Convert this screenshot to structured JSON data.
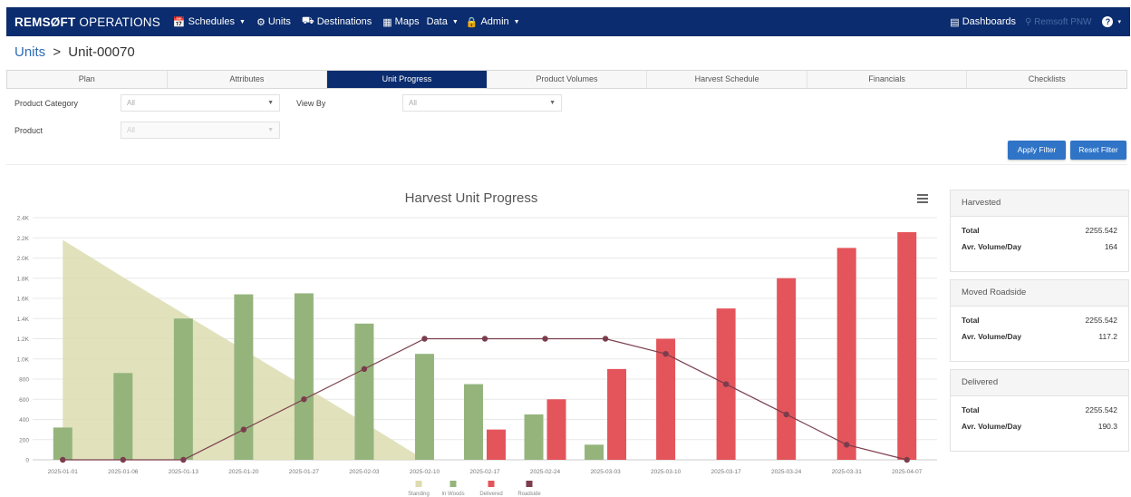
{
  "nav": {
    "brand": "REMSØFT",
    "brand_suffix": "OPERATIONS",
    "items": [
      {
        "label": "Schedules",
        "icon": "calendar-icon"
      },
      {
        "label": "Units",
        "icon": "units-icon"
      },
      {
        "label": "Destinations",
        "icon": "truck-icon"
      },
      {
        "label": "Maps",
        "icon": "map-icon"
      },
      {
        "label": "Data"
      },
      {
        "label": "Admin",
        "icon": "lock-icon"
      }
    ],
    "dashboards": "Dashboards",
    "org": "Remsoft PNW",
    "help_caret": "▾"
  },
  "breadcrumb": {
    "parent": "Units",
    "separator": ">",
    "current": "Unit-00070"
  },
  "tabs": [
    "Plan",
    "Attributes",
    "Unit Progress",
    "Product Volumes",
    "Harvest Schedule",
    "Financials",
    "Checklists"
  ],
  "filters": {
    "product_category": {
      "label": "Product Category",
      "value": "All"
    },
    "view_by": {
      "label": "View By",
      "value": "All"
    },
    "product": {
      "label": "Product",
      "value": "All"
    },
    "apply": "Apply Filter",
    "reset": "Reset Filter"
  },
  "colors": {
    "standing": "#dcdcb0",
    "in_woods": "#94b47c",
    "delivered": "#e4555b",
    "roadside": "#7b3d4d",
    "nav": "#0b2c6e"
  },
  "chart_data": {
    "type": "bar",
    "title": "Harvest Unit Progress",
    "categories": [
      "2025-01-01",
      "2025-01-06",
      "2025-01-13",
      "2025-01-20",
      "2025-01-27",
      "2025-02-03",
      "2025-02-10",
      "2025-02-17",
      "2025-02-24",
      "2025-03-03",
      "2025-03-10",
      "2025-03-17",
      "2025-03-24",
      "2025-03-31",
      "2025-04-07"
    ],
    "y_ticks": [
      "0",
      "200",
      "400",
      "600",
      "800",
      "1.0K",
      "1.2K",
      "1.4K",
      "1.6K",
      "1.8K",
      "2.0K",
      "2.2K",
      "2.4K"
    ],
    "ylim": [
      0,
      2400
    ],
    "grid": true,
    "legend_position": "bottom",
    "series": [
      {
        "name": "Standing",
        "type": "area",
        "values": [
          2180,
          1810,
          1450,
          1090,
          730,
          370,
          0,
          null,
          null,
          null,
          null,
          null,
          null,
          null,
          null
        ]
      },
      {
        "name": "In Woods",
        "type": "bar",
        "values": [
          320,
          860,
          1400,
          1640,
          1650,
          1350,
          1050,
          750,
          450,
          150,
          null,
          null,
          null,
          null,
          null
        ]
      },
      {
        "name": "Delivered",
        "type": "bar",
        "values": [
          null,
          null,
          null,
          null,
          null,
          null,
          null,
          300,
          600,
          900,
          1200,
          1500,
          1800,
          2100,
          2256
        ]
      },
      {
        "name": "Roadside",
        "type": "line",
        "values": [
          0,
          0,
          0,
          300,
          600,
          900,
          1200,
          1200,
          1200,
          1200,
          1050,
          750,
          450,
          150,
          0
        ]
      }
    ]
  },
  "cards": [
    {
      "title": "Harvested",
      "total_label": "Total",
      "total": "2255.542",
      "avg_label": "Avr. Volume/Day",
      "avg": "164"
    },
    {
      "title": "Moved Roadside",
      "total_label": "Total",
      "total": "2255.542",
      "avg_label": "Avr. Volume/Day",
      "avg": "117.2"
    },
    {
      "title": "Delivered",
      "total_label": "Total",
      "total": "2255.542",
      "avg_label": "Avr. Volume/Day",
      "avg": "190.3"
    }
  ]
}
